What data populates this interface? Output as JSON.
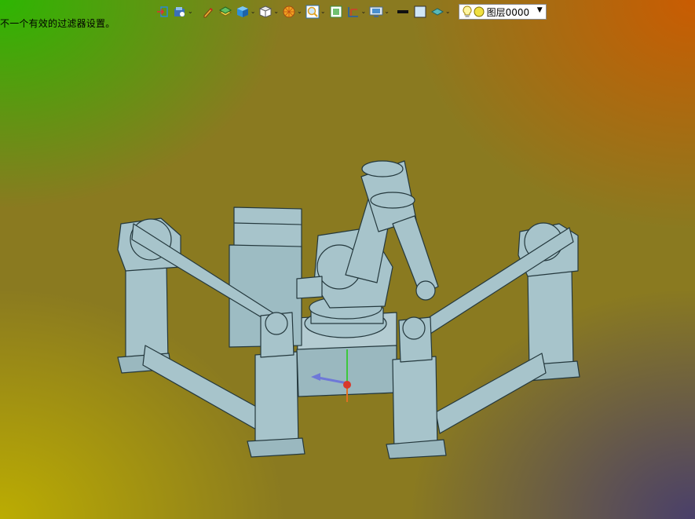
{
  "status_message": "不一个有效的过滤器设置。",
  "layer": {
    "name": "图层0000",
    "bulb_icon": "bulb-icon",
    "color_icon": "yellow-circle-icon"
  },
  "colors": {
    "model_fill": "#a7c4cb",
    "model_stroke": "#24383d",
    "axis_red": "#d8382c",
    "axis_green": "#3cc83c",
    "axis_blue": "#6e78d8"
  },
  "toolbar_icons": [
    "exit-sketch-icon",
    "view-orient-icon",
    "pen-icon",
    "layer-stack-icon",
    "cube-shaded-icon",
    "cube-wire-icon",
    "color-wheel-icon",
    "magnifier-icon",
    "fit-view-icon",
    "dimension-icon",
    "display-icon",
    "line-color-icon",
    "fill-color-icon",
    "transparency-icon"
  ]
}
